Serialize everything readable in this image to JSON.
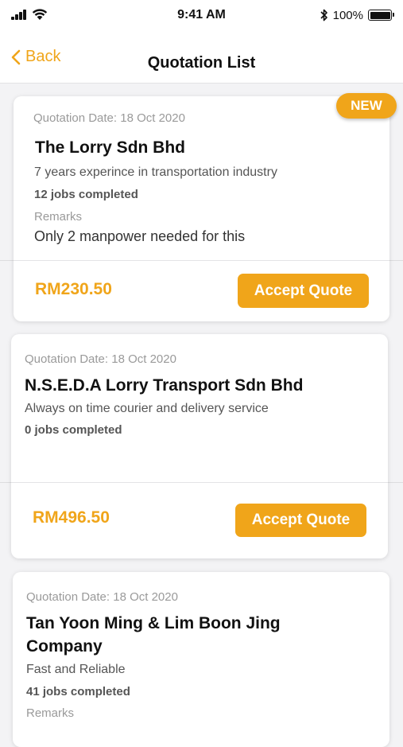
{
  "status_bar": {
    "time": "9:41 AM",
    "battery": "100%"
  },
  "nav": {
    "back_label": "Back",
    "title": "Quotation List"
  },
  "colors": {
    "accent": "#f0a51a",
    "background": "#f3f3f5"
  },
  "quotes": [
    {
      "date": "Quotation Date: 18 Oct 2020",
      "company": "The Lorry Sdn Bhd",
      "description": "7 years experince in transportation industry",
      "jobs": "12 jobs completed",
      "remarks_label": "Remarks",
      "remarks": "Only 2 manpower needed for this",
      "price": "RM230.50",
      "button": "Accept Quote",
      "badge": "NEW"
    },
    {
      "date": "Quotation Date: 18 Oct 2020",
      "company": "N.S.E.D.A Lorry Transport Sdn Bhd",
      "description": "Always on time courier and delivery service",
      "jobs": "0 jobs completed",
      "price": "RM496.50",
      "button": "Accept Quote"
    },
    {
      "date": "Quotation Date: 18 Oct 2020",
      "company": "Tan Yoon Ming & Lim Boon Jing Company",
      "description": "Fast and Reliable",
      "jobs": "41 jobs completed",
      "remarks_label": "Remarks"
    }
  ]
}
